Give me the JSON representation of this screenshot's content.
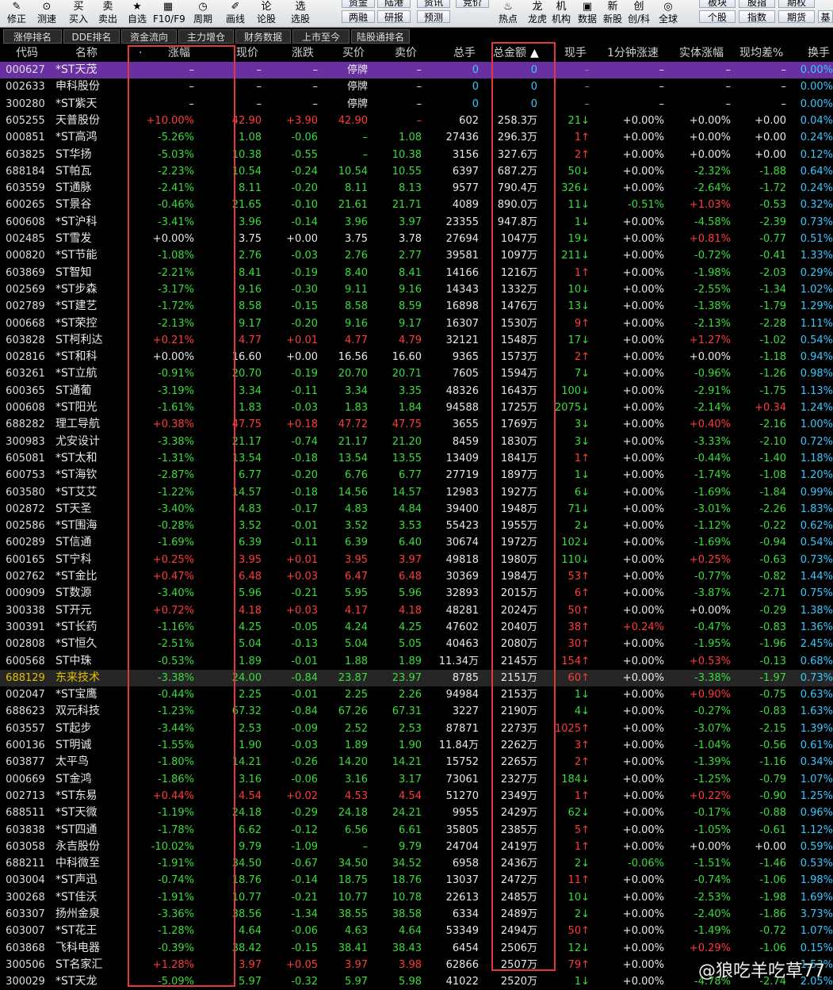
{
  "toolbar": {
    "items": [
      {
        "label": "修正",
        "icon": "✎"
      },
      {
        "label": "测速",
        "icon": "⊙"
      },
      {
        "label": "买入",
        "icon": "买"
      },
      {
        "label": "卖出",
        "icon": "卖"
      },
      {
        "label": "自选",
        "icon": "★"
      },
      {
        "label": "F10/F9",
        "icon": "▦"
      },
      {
        "label": "周期",
        "icon": "◷"
      },
      {
        "label": "画线",
        "icon": "✐"
      },
      {
        "label": "论股",
        "icon": "论"
      },
      {
        "label": "选股",
        "icon": "选"
      }
    ],
    "mid_top": [
      "资金",
      "陆港",
      "资讯",
      "竞价"
    ],
    "mid_bottom": [
      "两融",
      "研报",
      "预测"
    ],
    "right_items": [
      {
        "label": "热点",
        "icon": "♨"
      },
      {
        "label": "龙虎",
        "icon": "龙"
      },
      {
        "label": "机构",
        "icon": "机"
      },
      {
        "label": "数据",
        "icon": "▣"
      },
      {
        "label": "新股",
        "icon": "新"
      },
      {
        "label": "创/科",
        "icon": "创"
      },
      {
        "label": "全球",
        "icon": "◎"
      }
    ],
    "far_top": [
      "板块",
      "股指",
      "期权"
    ],
    "far_bottom": [
      "个股",
      "指数",
      "期货"
    ],
    "edge": "基"
  },
  "tabs": [
    "涨停排名",
    "DDE排名",
    "资金流向",
    "主力增仓",
    "财务数据",
    "上市至今",
    "陆股通排名"
  ],
  "header": {
    "code": "代码",
    "name": "名称",
    "change_pct": "涨幅",
    "price": "现价",
    "change": "涨跌",
    "bid": "买价",
    "ask": "卖价",
    "volume": "总手",
    "amount": "总金额",
    "cur_vol": "现手",
    "speed": "1分钟涨速",
    "body_pct": "实体涨幅",
    "avg_diff": "现均差%",
    "turnover": "换手",
    "sort_arrow": "▲",
    "dot": "·"
  },
  "watermark": "@狼吃羊吃草77",
  "colors": {
    "red": "#ff3b3b",
    "green": "#3bdc3b",
    "highlight_row": "#6a2fa0",
    "box": "#e23a3a"
  },
  "rows": [
    [
      "000627",
      "*ST天茂",
      "–",
      "–",
      "–",
      "停牌",
      "–",
      "0",
      "0",
      "–",
      "–",
      "–",
      "–",
      "0.00%"
    ],
    [
      "002633",
      "申科股份",
      "–",
      "–",
      "–",
      "停牌",
      "–",
      "0",
      "0",
      "–",
      "–",
      "–",
      "–",
      "0.00%"
    ],
    [
      "300280",
      "*ST紫天",
      "–",
      "–",
      "–",
      "停牌",
      "–",
      "0",
      "0",
      "–",
      "–",
      "–",
      "–",
      "0.00%"
    ],
    [
      "605255",
      "天普股份",
      "+10.00%",
      "42.90",
      "+3.90",
      "42.90",
      "–",
      "602",
      "258.3万",
      "21↓",
      "+0.00%",
      "+0.00%",
      "+0.00",
      "0.04%"
    ],
    [
      "000851",
      "*ST高鸿",
      "-5.26%",
      "1.08",
      "-0.06",
      "–",
      "1.08",
      "27436",
      "296.3万",
      "1↑",
      "+0.00%",
      "+0.00%",
      "+0.00",
      "0.24%"
    ],
    [
      "603825",
      "ST华扬",
      "-5.03%",
      "10.38",
      "-0.55",
      "–",
      "10.38",
      "3156",
      "327.6万",
      "2↑",
      "+0.00%",
      "+0.00%",
      "+0.00",
      "0.12%"
    ],
    [
      "688184",
      "ST帕瓦",
      "-2.23%",
      "10.54",
      "-0.24",
      "10.54",
      "10.55",
      "6397",
      "687.2万",
      "50↓",
      "+0.00%",
      "-2.32%",
      "-1.88",
      "0.64%"
    ],
    [
      "603559",
      "ST通脉",
      "-2.41%",
      "8.11",
      "-0.20",
      "8.11",
      "8.13",
      "9577",
      "790.4万",
      "326↓",
      "+0.00%",
      "-2.64%",
      "-1.72",
      "0.24%"
    ],
    [
      "600265",
      "ST景谷",
      "-0.46%",
      "21.65",
      "-0.10",
      "21.61",
      "21.71",
      "4089",
      "890.0万",
      "11↓",
      "-0.51%",
      "+1.03%",
      "-0.53",
      "0.32%"
    ],
    [
      "600608",
      "*ST沪科",
      "-3.41%",
      "3.96",
      "-0.14",
      "3.96",
      "3.97",
      "23355",
      "947.8万",
      "1↓",
      "+0.00%",
      "-4.58%",
      "-2.39",
      "0.73%"
    ],
    [
      "002485",
      "ST雪发",
      "+0.00%",
      "3.75",
      "+0.00",
      "3.75",
      "3.78",
      "27694",
      "1047万",
      "19↓",
      "+0.00%",
      "+0.81%",
      "-0.77",
      "0.51%"
    ],
    [
      "000820",
      "*ST节能",
      "-1.08%",
      "2.76",
      "-0.03",
      "2.76",
      "2.77",
      "39581",
      "1097万",
      "211↓",
      "+0.00%",
      "-0.72%",
      "-0.41",
      "1.33%"
    ],
    [
      "603869",
      "ST智知",
      "-2.21%",
      "8.41",
      "-0.19",
      "8.40",
      "8.41",
      "14166",
      "1216万",
      "1↑",
      "+0.00%",
      "-1.98%",
      "-2.03",
      "0.29%"
    ],
    [
      "002569",
      "*ST步森",
      "-3.17%",
      "9.16",
      "-0.30",
      "9.11",
      "9.16",
      "14343",
      "1332万",
      "10↓",
      "+0.00%",
      "-2.55%",
      "-1.34",
      "1.02%"
    ],
    [
      "002789",
      "*ST建艺",
      "-1.72%",
      "8.58",
      "-0.15",
      "8.58",
      "8.59",
      "16898",
      "1476万",
      "13↓",
      "+0.00%",
      "-1.38%",
      "-1.79",
      "1.29%"
    ],
    [
      "000668",
      "*ST荣控",
      "-2.13%",
      "9.17",
      "-0.20",
      "9.16",
      "9.17",
      "16307",
      "1530万",
      "9↑",
      "+0.00%",
      "-2.13%",
      "-2.28",
      "1.11%"
    ],
    [
      "603828",
      "ST柯利达",
      "+0.21%",
      "4.77",
      "+0.01",
      "4.77",
      "4.79",
      "32121",
      "1548万",
      "17↓",
      "+0.00%",
      "+1.27%",
      "-1.02",
      "0.54%"
    ],
    [
      "002816",
      "*ST和科",
      "+0.00%",
      "16.60",
      "+0.00",
      "16.56",
      "16.60",
      "9365",
      "1573万",
      "2↑",
      "+0.00%",
      "+0.00%",
      "-1.18",
      "0.94%"
    ],
    [
      "603261",
      "*ST立航",
      "-0.91%",
      "20.70",
      "-0.19",
      "20.70",
      "20.71",
      "7605",
      "1594万",
      "7↓",
      "+0.00%",
      "-0.96%",
      "-1.26",
      "0.98%"
    ],
    [
      "600365",
      "ST通葡",
      "-3.19%",
      "3.34",
      "-0.11",
      "3.34",
      "3.35",
      "48326",
      "1643万",
      "100↓",
      "+0.00%",
      "-2.91%",
      "-1.75",
      "1.13%"
    ],
    [
      "000608",
      "*ST阳光",
      "-1.61%",
      "1.83",
      "-0.03",
      "1.83",
      "1.84",
      "94588",
      "1725万",
      "2075↓",
      "+0.00%",
      "-2.14%",
      "+0.34",
      "1.24%"
    ],
    [
      "688282",
      "理工导航",
      "+0.38%",
      "47.75",
      "+0.18",
      "47.72",
      "47.75",
      "3655",
      "1769万",
      "3↓",
      "+0.00%",
      "+0.40%",
      "-2.16",
      "1.00%"
    ],
    [
      "300983",
      "尤安设计",
      "-3.38%",
      "21.17",
      "-0.74",
      "21.17",
      "21.20",
      "8459",
      "1830万",
      "3↓",
      "+0.00%",
      "-3.33%",
      "-2.10",
      "0.72%"
    ],
    [
      "605081",
      "*ST太和",
      "-1.31%",
      "13.54",
      "-0.18",
      "13.54",
      "13.55",
      "13409",
      "1841万",
      "1↑",
      "+0.00%",
      "-0.44%",
      "-1.40",
      "1.18%"
    ],
    [
      "600753",
      "*ST海钦",
      "-2.87%",
      "6.77",
      "-0.20",
      "6.76",
      "6.77",
      "27719",
      "1897万",
      "1↓",
      "+0.00%",
      "-1.74%",
      "-1.08",
      "1.20%"
    ],
    [
      "603580",
      "*ST艾艾",
      "-1.22%",
      "14.57",
      "-0.18",
      "14.56",
      "14.57",
      "12983",
      "1927万",
      "6↓",
      "+0.00%",
      "-1.69%",
      "-1.84",
      "0.99%"
    ],
    [
      "002872",
      "ST天圣",
      "-3.40%",
      "4.83",
      "-0.17",
      "4.83",
      "4.84",
      "39400",
      "1948万",
      "71↓",
      "+0.00%",
      "-3.01%",
      "-2.26",
      "1.83%"
    ],
    [
      "002586",
      "*ST围海",
      "-0.28%",
      "3.52",
      "-0.01",
      "3.52",
      "3.53",
      "55423",
      "1955万",
      "2↓",
      "+0.00%",
      "-1.12%",
      "-0.22",
      "0.62%"
    ],
    [
      "600289",
      "ST信通",
      "-1.69%",
      "6.39",
      "-0.11",
      "6.39",
      "6.40",
      "30674",
      "1972万",
      "102↓",
      "+0.00%",
      "-1.69%",
      "-0.94",
      "0.54%"
    ],
    [
      "600165",
      "ST宁科",
      "+0.25%",
      "3.95",
      "+0.01",
      "3.95",
      "3.97",
      "49818",
      "1980万",
      "110↓",
      "+0.00%",
      "+0.25%",
      "-0.63",
      "0.73%"
    ],
    [
      "002762",
      "*ST金比",
      "+0.47%",
      "6.48",
      "+0.03",
      "6.47",
      "6.48",
      "30369",
      "1984万",
      "53↑",
      "+0.00%",
      "-0.77%",
      "-0.82",
      "1.44%"
    ],
    [
      "000909",
      "ST数源",
      "-3.40%",
      "5.96",
      "-0.21",
      "5.95",
      "5.96",
      "32893",
      "2015万",
      "6↑",
      "+0.00%",
      "-3.87%",
      "-2.71",
      "0.75%"
    ],
    [
      "300338",
      "ST开元",
      "+0.72%",
      "4.18",
      "+0.03",
      "4.17",
      "4.18",
      "48281",
      "2024万",
      "50↑",
      "+0.00%",
      "+0.00%",
      "-0.29",
      "1.38%"
    ],
    [
      "300391",
      "*ST长药",
      "-1.16%",
      "4.25",
      "-0.05",
      "4.24",
      "4.25",
      "47602",
      "2040万",
      "38↑",
      "+0.24%",
      "-0.47%",
      "-0.83",
      "1.36%"
    ],
    [
      "002808",
      "*ST恒久",
      "-2.51%",
      "5.04",
      "-0.13",
      "5.04",
      "5.05",
      "40463",
      "2080万",
      "30↑",
      "+0.00%",
      "-1.95%",
      "-1.96",
      "2.45%"
    ],
    [
      "600568",
      "ST中珠",
      "-0.53%",
      "1.89",
      "-0.01",
      "1.88",
      "1.89",
      "11.34万",
      "2145万",
      "154↑",
      "+0.00%",
      "+0.53%",
      "-0.13",
      "0.68%"
    ],
    [
      "688129",
      "东来技术",
      "-3.38%",
      "24.00",
      "-0.84",
      "23.87",
      "23.97",
      "8785",
      "2151万",
      "60↑",
      "+0.00%",
      "-3.38%",
      "-1.97",
      "0.73%"
    ],
    [
      "002047",
      "*ST宝鹰",
      "-0.44%",
      "2.25",
      "-0.01",
      "2.25",
      "2.26",
      "94984",
      "2153万",
      "1↓",
      "+0.00%",
      "+0.90%",
      "-0.75",
      "0.63%"
    ],
    [
      "688623",
      "双元科技",
      "-1.23%",
      "67.32",
      "-0.84",
      "67.26",
      "67.31",
      "3227",
      "2190万",
      "4↓",
      "+0.00%",
      "-0.27%",
      "-0.83",
      "1.63%"
    ],
    [
      "603557",
      "ST起步",
      "-3.44%",
      "2.53",
      "-0.09",
      "2.52",
      "2.53",
      "87871",
      "2273万",
      "1025↑",
      "+0.00%",
      "-3.07%",
      "-2.15",
      "1.39%"
    ],
    [
      "600136",
      "ST明诚",
      "-1.55%",
      "1.90",
      "-0.03",
      "1.89",
      "1.90",
      "11.84万",
      "2262万",
      "3↑",
      "+0.00%",
      "-1.04%",
      "-0.56",
      "0.61%"
    ],
    [
      "603877",
      "太平鸟",
      "-1.80%",
      "14.21",
      "-0.26",
      "14.20",
      "14.21",
      "15752",
      "2265万",
      "2↑",
      "+0.00%",
      "-1.39%",
      "-1.16",
      "0.34%"
    ],
    [
      "000669",
      "ST金鸿",
      "-1.86%",
      "3.16",
      "-0.06",
      "3.16",
      "3.17",
      "73061",
      "2327万",
      "184↓",
      "+0.00%",
      "-1.25%",
      "-0.79",
      "1.07%"
    ],
    [
      "002713",
      "*ST东易",
      "+0.44%",
      "4.54",
      "+0.02",
      "4.53",
      "4.54",
      "51270",
      "2349万",
      "1↑",
      "+0.00%",
      "+0.22%",
      "-0.90",
      "1.25%"
    ],
    [
      "688511",
      "*ST天微",
      "-1.19%",
      "24.18",
      "-0.29",
      "24.18",
      "24.21",
      "9955",
      "2429万",
      "62↓",
      "+0.00%",
      "-0.17%",
      "-0.88",
      "0.96%"
    ],
    [
      "603838",
      "*ST四通",
      "-1.78%",
      "6.62",
      "-0.12",
      "6.56",
      "6.61",
      "35805",
      "2385万",
      "5↑",
      "+0.00%",
      "-1.05%",
      "-0.61",
      "1.12%"
    ],
    [
      "603058",
      "永吉股份",
      "-10.02%",
      "9.79",
      "-1.09",
      "–",
      "9.79",
      "24704",
      "2419万",
      "1↑",
      "+0.00%",
      "+0.00%",
      "+0.00",
      "0.59%"
    ],
    [
      "688211",
      "中科微至",
      "-1.91%",
      "34.50",
      "-0.67",
      "34.50",
      "34.52",
      "6958",
      "2436万",
      "2↓",
      "-0.06%",
      "-1.51%",
      "-1.46",
      "0.53%"
    ],
    [
      "003004",
      "*ST声迅",
      "-0.74%",
      "18.76",
      "-0.14",
      "18.75",
      "18.76",
      "13037",
      "2472万",
      "11↑",
      "+0.00%",
      "-0.74%",
      "-1.06",
      "1.98%"
    ],
    [
      "300268",
      "*ST佳沃",
      "-1.91%",
      "10.77",
      "-0.21",
      "10.77",
      "10.78",
      "22613",
      "2485万",
      "10↓",
      "+0.00%",
      "-2.53%",
      "-1.98",
      "1.69%"
    ],
    [
      "603307",
      "扬州金泉",
      "-3.36%",
      "38.56",
      "-1.34",
      "38.55",
      "38.58",
      "6334",
      "2489万",
      "2↓",
      "+0.00%",
      "-2.40%",
      "-1.86",
      "3.73%"
    ],
    [
      "603007",
      "*ST花王",
      "-1.28%",
      "4.64",
      "-0.06",
      "4.63",
      "4.64",
      "53349",
      "2494万",
      "50↑",
      "+0.00%",
      "-1.49%",
      "-0.72",
      "1.07%"
    ],
    [
      "603868",
      "飞科电器",
      "-0.39%",
      "38.42",
      "-0.15",
      "38.41",
      "38.43",
      "6454",
      "2506万",
      "12↓",
      "+0.00%",
      "+0.29%",
      "-1.06",
      "0.15%"
    ],
    [
      "300506",
      "ST名家汇",
      "+1.28%",
      "3.97",
      "+0.05",
      "3.97",
      "3.98",
      "62866",
      "2507万",
      "79↑",
      "+0.00%",
      "",
      "",
      "1.53%"
    ],
    [
      "300029",
      "*ST天龙",
      "-5.09%",
      "5.97",
      "-0.32",
      "5.97",
      "5.98",
      "41022",
      "2520万",
      "1↓",
      "+0.00%",
      "-4.78%",
      "-2.74",
      "2.05%"
    ]
  ]
}
